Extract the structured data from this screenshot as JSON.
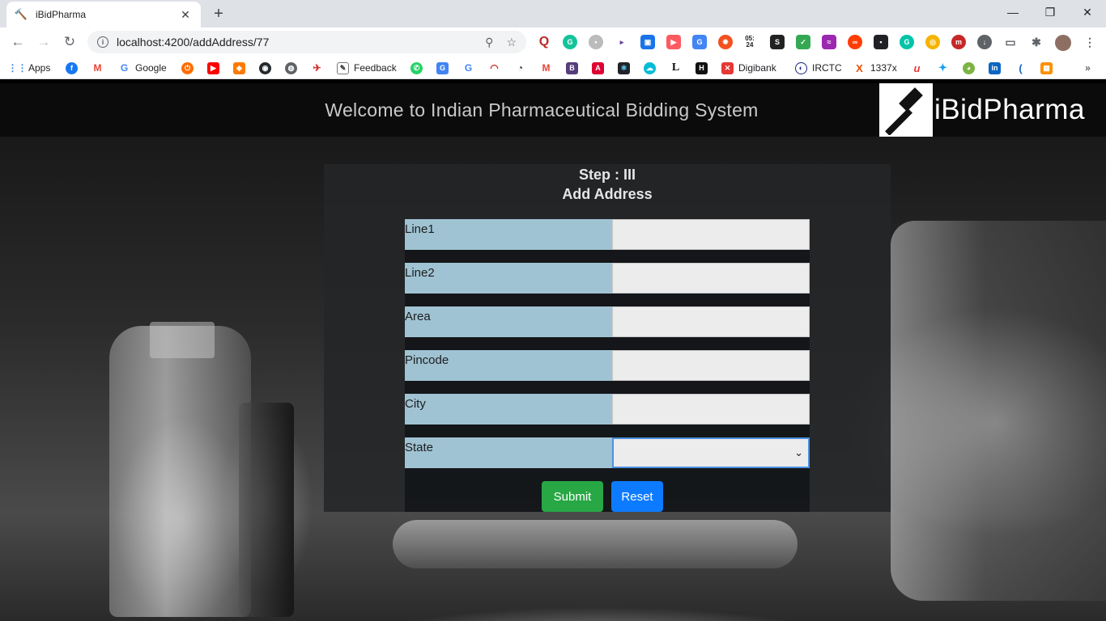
{
  "browser": {
    "tab_title": "iBidPharma",
    "url": "localhost:4200/addAddress/77",
    "clock_ext": "05:\n24",
    "bookmarks": {
      "apps": "Apps",
      "google": "Google",
      "feedback": "Feedback",
      "digibank": "Digibank",
      "irctc": "IRCTC",
      "x1337": "1337x"
    }
  },
  "site": {
    "welcome": "Welcome to Indian Pharmaceutical Bidding System",
    "logo_text": "iBidPharma"
  },
  "form": {
    "step": "Step : III",
    "heading": "Add Address",
    "fields": [
      {
        "label": "Line1",
        "value": ""
      },
      {
        "label": "Line2",
        "value": ""
      },
      {
        "label": "Area",
        "value": ""
      },
      {
        "label": "Pincode",
        "value": ""
      },
      {
        "label": "City",
        "value": ""
      },
      {
        "label": "State",
        "value": ""
      }
    ],
    "submit_label": "Submit",
    "reset_label": "Reset"
  },
  "colors": {
    "label_bg": "#9fc3d3",
    "submit": "#28a745",
    "reset": "#0d7bff"
  }
}
